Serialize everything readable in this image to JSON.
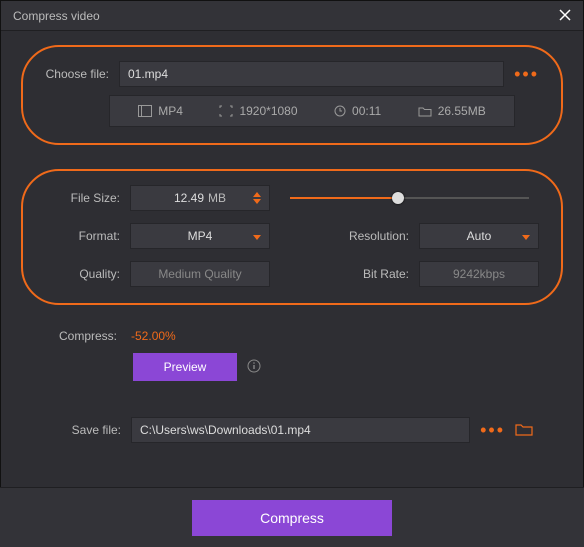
{
  "title": "Compress video",
  "choose": {
    "label": "Choose file:",
    "filename": "01.mp4",
    "format": "MP4",
    "resolution": "1920*1080",
    "duration": "00:11",
    "size": "26.55MB"
  },
  "settings": {
    "filesize_label": "File Size:",
    "filesize_value": "12.49",
    "filesize_unit": "MB",
    "slider_percent": 45,
    "format_label": "Format:",
    "format_value": "MP4",
    "resolution_label": "Resolution:",
    "resolution_value": "Auto",
    "quality_label": "Quality:",
    "quality_value": "Medium Quality",
    "bitrate_label": "Bit Rate:",
    "bitrate_value": "9242kbps"
  },
  "compress": {
    "label": "Compress:",
    "value": "-52.00%"
  },
  "preview_label": "Preview",
  "save": {
    "label": "Save file:",
    "path": "C:\\Users\\ws\\Downloads\\01.mp4"
  },
  "main_button": "Compress"
}
